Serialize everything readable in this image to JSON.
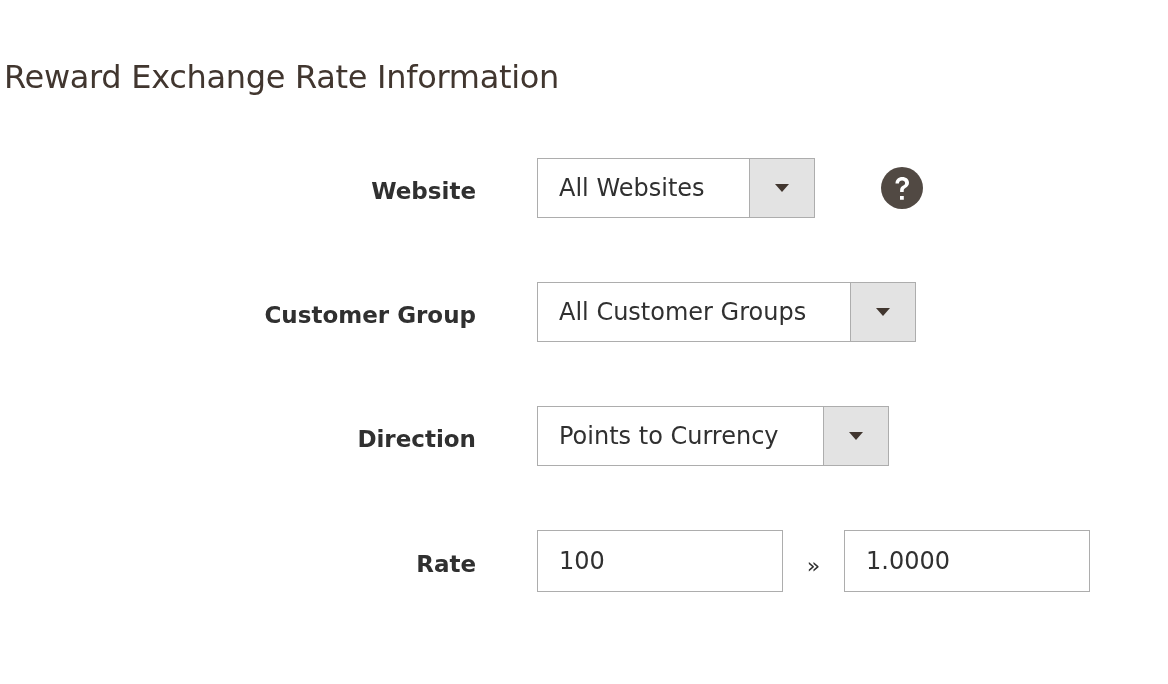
{
  "title": "Reward Exchange Rate Information",
  "fields": [
    {
      "kind": "select",
      "label": "Website",
      "value": "All Websites",
      "help": true
    },
    {
      "kind": "select",
      "label": "Customer Group",
      "value": "All Customer Groups"
    },
    {
      "kind": "select",
      "label": "Direction",
      "value": "Points to Currency"
    },
    {
      "kind": "rate",
      "label": "Rate",
      "from": "100",
      "separator": "»",
      "to": "1.0000"
    }
  ]
}
